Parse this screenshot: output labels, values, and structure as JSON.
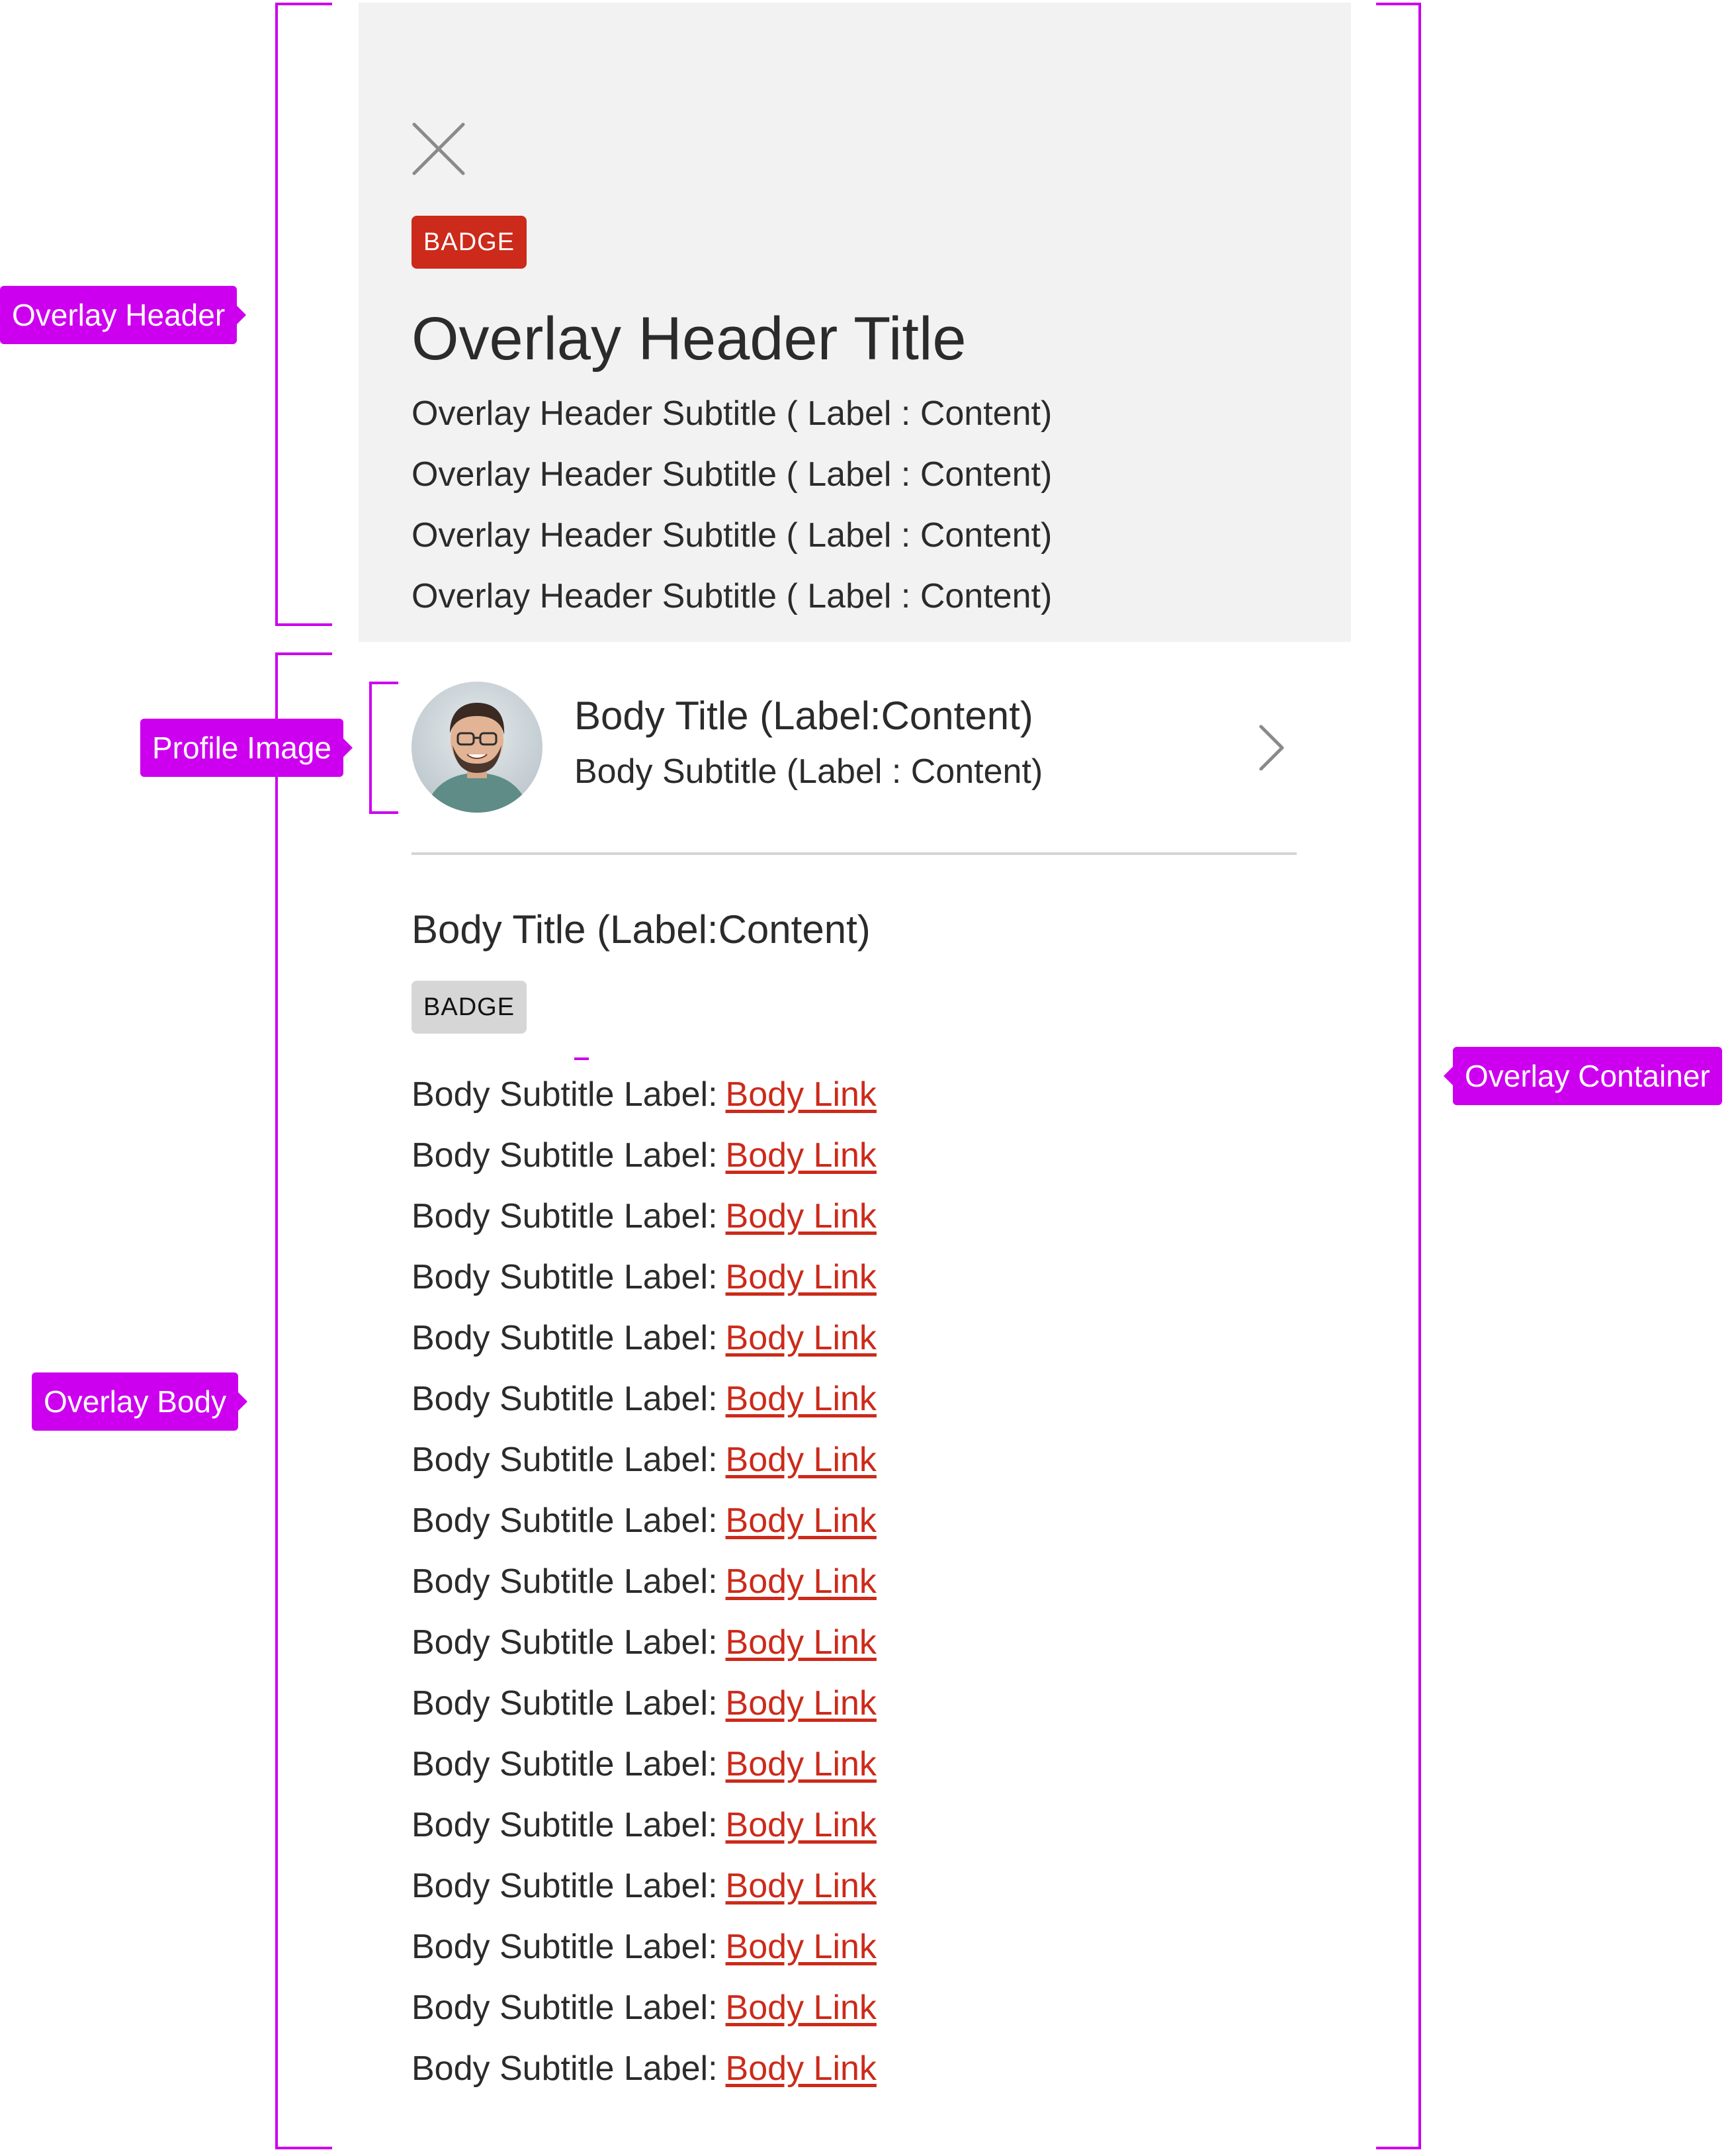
{
  "annotations": {
    "overlay_header": "Overlay Header",
    "profile_image": "Profile Image",
    "overlay_body": "Overlay Body",
    "overlay_container": "Overlay Container"
  },
  "colors": {
    "annotation": "#cc00ee",
    "badge_red": "#cc2a1a",
    "link": "#cc2a1a",
    "header_bg": "#f2f2f2"
  },
  "header": {
    "close_icon": "close-icon",
    "badge": "BADGE",
    "title": "Overlay Header Title",
    "subtitles": [
      "Overlay Header Subtitle ( Label : Content)",
      "Overlay Header Subtitle ( Label : Content)",
      "Overlay Header Subtitle ( Label : Content)",
      "Overlay Header Subtitle ( Label : Content)"
    ]
  },
  "profile": {
    "title": "Body Title (Label:Content)",
    "subtitle": "Body Subtitle (Label : Content)",
    "chevron_icon": "chevron-right-icon"
  },
  "body": {
    "section_title": "Body Title (Label:Content)",
    "badge": "BADGE",
    "items": [
      {
        "label": "Body Subtitle Label:",
        "link": "Body Link"
      },
      {
        "label": "Body Subtitle Label:",
        "link": "Body Link"
      },
      {
        "label": "Body Subtitle Label:",
        "link": "Body Link"
      },
      {
        "label": "Body Subtitle Label:",
        "link": "Body Link"
      },
      {
        "label": "Body Subtitle Label:",
        "link": "Body Link"
      },
      {
        "label": "Body Subtitle Label:",
        "link": "Body Link"
      },
      {
        "label": "Body Subtitle Label:",
        "link": "Body Link"
      },
      {
        "label": "Body Subtitle Label:",
        "link": "Body Link"
      },
      {
        "label": "Body Subtitle Label:",
        "link": "Body Link"
      },
      {
        "label": "Body Subtitle Label:",
        "link": "Body Link"
      },
      {
        "label": "Body Subtitle Label:",
        "link": "Body Link"
      },
      {
        "label": "Body Subtitle Label:",
        "link": "Body Link"
      },
      {
        "label": "Body Subtitle Label:",
        "link": "Body Link"
      },
      {
        "label": "Body Subtitle Label:",
        "link": "Body Link"
      },
      {
        "label": "Body Subtitle Label:",
        "link": "Body Link"
      },
      {
        "label": "Body Subtitle Label:",
        "link": "Body Link"
      },
      {
        "label": "Body Subtitle Label:",
        "link": "Body Link"
      }
    ]
  }
}
